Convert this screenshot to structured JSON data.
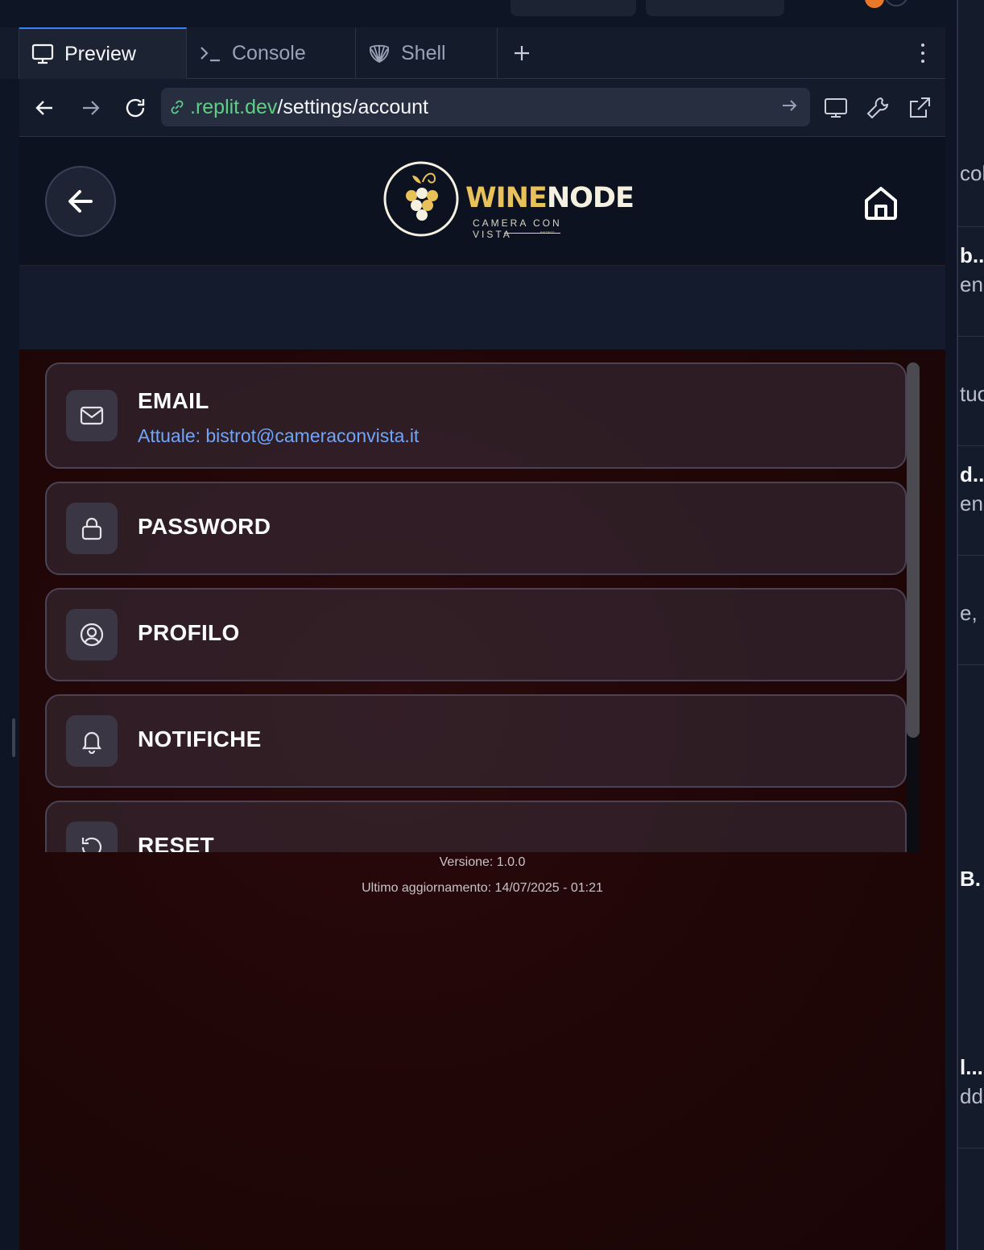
{
  "tabs": [
    {
      "label": "Preview",
      "icon": "monitor-icon",
      "active": true
    },
    {
      "label": "Console",
      "icon": "terminal-icon",
      "active": false
    },
    {
      "label": "Shell",
      "icon": "shell-icon",
      "active": false
    }
  ],
  "address": {
    "host": ".replit.dev",
    "path": "/settings/account"
  },
  "app": {
    "logo_word_1": "WINE",
    "logo_word_2": "NODE",
    "logo_subtitle": "CAMERA CON VISTA",
    "logo_mini": "BISTROT"
  },
  "settings": [
    {
      "title": "EMAIL",
      "subtitle": "Attuale: bistrot@cameraconvista.it",
      "icon": "mail-icon"
    },
    {
      "title": "PASSWORD",
      "icon": "lock-icon"
    },
    {
      "title": "PROFILO",
      "icon": "user-circle-icon"
    },
    {
      "title": "NOTIFICHE",
      "icon": "bell-icon"
    },
    {
      "title": "RESET",
      "icon": "reset-icon"
    }
  ],
  "footer": {
    "version": "Versione: 1.0.0",
    "updated": "Ultimo aggiornamento: 14/07/2025 - 01:21"
  },
  "right_sidebar_fragments": [
    "colc",
    "b..",
    "eno",
    "tuo",
    "d..",
    "enu",
    "e, s",
    "B.",
    "l...",
    "dds"
  ],
  "colors": {
    "accent_blue": "#3b82f6",
    "url_host_green": "#5fcf85",
    "logo_gold": "#e8c15a",
    "email_link": "#6fa5ff",
    "wine_background": "#200607"
  }
}
